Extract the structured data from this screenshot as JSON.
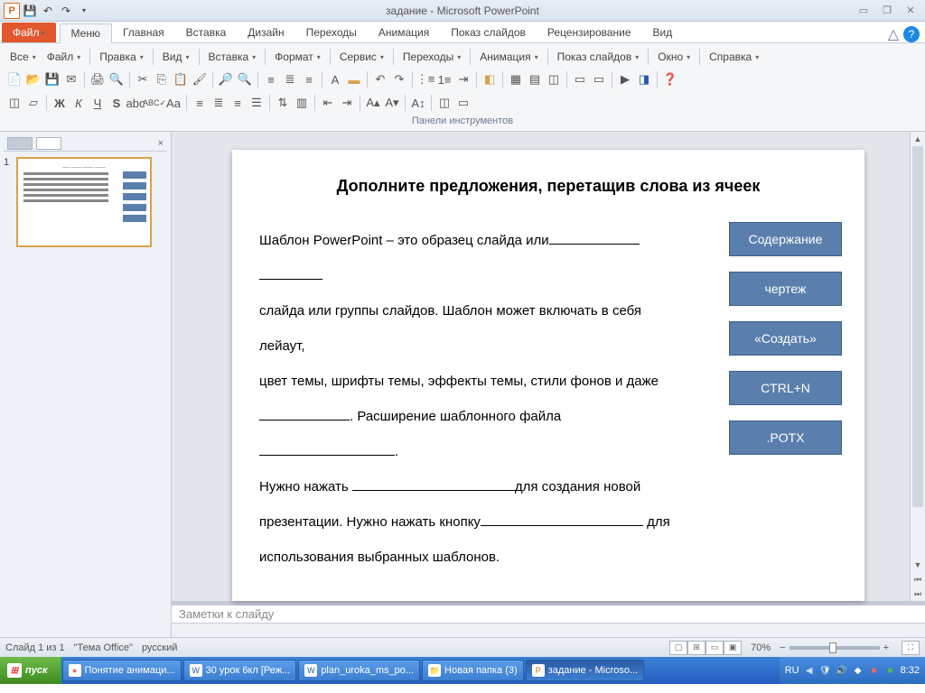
{
  "titlebar": {
    "app_title": "задание  -  Microsoft PowerPoint"
  },
  "tabs": {
    "file": "Файл",
    "items": [
      "Меню",
      "Главная",
      "Вставка",
      "Дизайн",
      "Переходы",
      "Анимация",
      "Показ слайдов",
      "Рецензирование",
      "Вид"
    ],
    "active_index": 0
  },
  "menu_row": [
    "Все",
    "Файл",
    "Правка",
    "Вид",
    "Вставка",
    "Формат",
    "Сервис",
    "Переходы",
    "Анимация",
    "Показ слайдов",
    "Окно",
    "Справка"
  ],
  "ribbon_group_label": "Панели инструментов",
  "slide": {
    "title": "Дополните предложения, перетащив слова из ячеек",
    "p1a": "Шаблон PowerPoint – это образец слайда или",
    "p2": "слайда или группы слайдов. Шаблон может включать в себя лейаут,",
    "p3": "цвет темы, шрифты темы, эффекты темы, стили фонов и даже",
    "p4": ". Расширение шаблонного файла ",
    "p4end": ".",
    "p5a": "Нужно нажать ",
    "p5b": "для создания новой",
    "p6a": "презентации. Нужно нажать кнопку",
    "p6b": " для",
    "p7": "использования выбранных шаблонов.",
    "answers": [
      "Содержание",
      "чертеж",
      "«Создать»",
      "CTRL+N",
      ".POTX"
    ]
  },
  "thumb": {
    "num": "1"
  },
  "notes_placeholder": "Заметки к слайду",
  "statusbar": {
    "slide_info": "Слайд 1 из 1",
    "theme": "\"Тема Office\"",
    "lang": "русский",
    "zoom": "70%"
  },
  "taskbar": {
    "start": "пуск",
    "items": [
      {
        "icon": "🦊",
        "label": "Понятие анимаци..."
      },
      {
        "icon": "W",
        "label": "30 урок 6кл [Реж..."
      },
      {
        "icon": "W",
        "label": "plan_uroka_ms_po..."
      },
      {
        "icon": "📁",
        "label": "Новая папка (3)"
      },
      {
        "icon": "P",
        "label": "задание - Microso...",
        "active": true
      }
    ],
    "lang": "RU",
    "time": "8:32"
  }
}
